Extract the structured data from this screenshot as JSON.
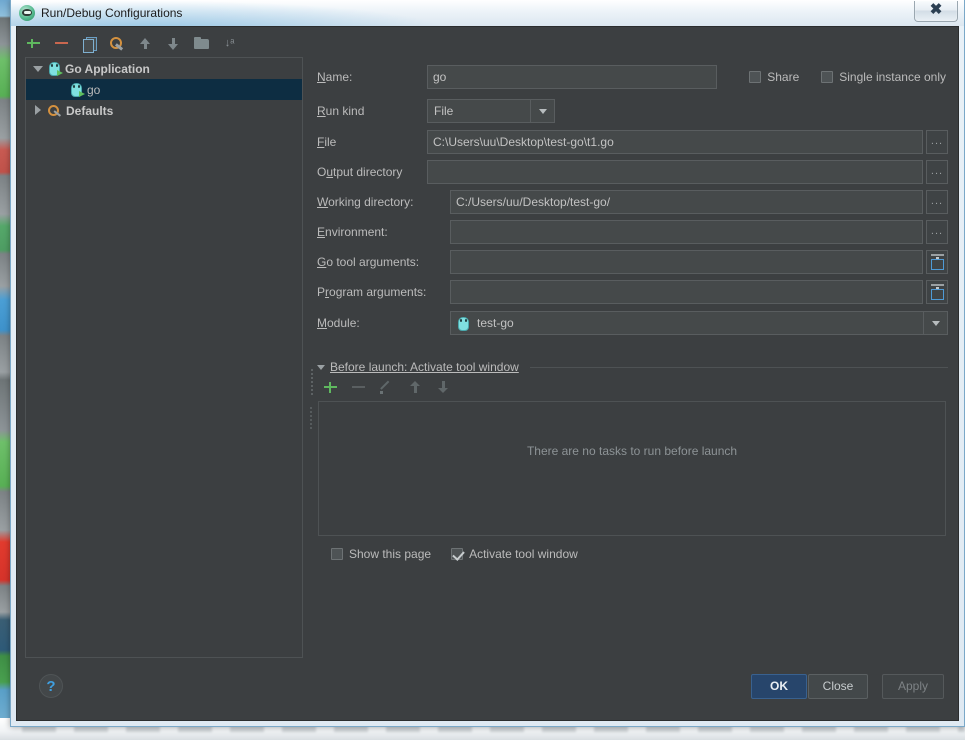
{
  "window": {
    "title": "Run/Debug Configurations",
    "title_icon": "go-app-icon",
    "close_label": "✕"
  },
  "left_panel": {
    "toolbar": [
      {
        "name": "add-configuration-button",
        "icon": "plus-icon",
        "label": "+"
      },
      {
        "name": "remove-configuration-button",
        "icon": "minus-icon",
        "label": "−"
      },
      {
        "name": "copy-configuration-button",
        "icon": "copy-icon",
        "label": ""
      },
      {
        "name": "edit-templates-button",
        "icon": "wrench-icon",
        "label": ""
      },
      {
        "name": "move-up-button",
        "icon": "arrow-up-icon",
        "label": ""
      },
      {
        "name": "move-down-button",
        "icon": "arrow-down-icon",
        "label": ""
      },
      {
        "name": "move-into-folder-button",
        "icon": "folder-icon",
        "label": ""
      },
      {
        "name": "sort-configurations-button",
        "icon": "sort-az-icon",
        "label": "↓ᵃ𝘇"
      }
    ],
    "tree": [
      {
        "name": "tree-group-go-application",
        "label": "Go Application",
        "icon": "go-gopher-icon",
        "expanded": true,
        "selected": false,
        "level": 0
      },
      {
        "name": "tree-item-go",
        "label": "go",
        "icon": "go-gopher-icon",
        "expanded": false,
        "selected": true,
        "level": 1
      },
      {
        "name": "tree-group-defaults",
        "label": "Defaults",
        "icon": "wrench-icon",
        "expanded": false,
        "selected": false,
        "level": 0
      }
    ]
  },
  "form": {
    "name_label": "Name:",
    "name_value": "go",
    "share_label": "Share",
    "share_checked": false,
    "single_instance_label": "Single instance only",
    "single_instance_checked": false,
    "run_kind_label": "Run kind",
    "run_kind_value": "File",
    "file_label": "File",
    "file_value": "C:\\Users\\uu\\Desktop\\test-go\\t1.go",
    "output_directory_label": "Output directory",
    "output_directory_value": "",
    "working_directory_label": "Working directory:",
    "working_directory_value": "C:/Users/uu/Desktop/test-go/",
    "environment_label": "Environment:",
    "environment_value": "",
    "go_tool_arguments_label": "Go tool arguments:",
    "go_tool_arguments_value": "",
    "program_arguments_label": "Program arguments:",
    "program_arguments_value": "",
    "module_label": "Module:",
    "module_value": "test-go",
    "browse_button_label": "...",
    "expand_button_icon": "insert-macro-icon"
  },
  "before_launch": {
    "header": "Before launch: Activate tool window",
    "toolbar": [
      {
        "name": "add-task-button",
        "icon": "plus-icon",
        "enabled": true
      },
      {
        "name": "remove-task-button",
        "icon": "minus-icon",
        "enabled": false
      },
      {
        "name": "edit-task-button",
        "icon": "pencil-icon",
        "enabled": false
      },
      {
        "name": "move-task-up-button",
        "icon": "arrow-up-icon",
        "enabled": false
      },
      {
        "name": "move-task-down-button",
        "icon": "arrow-down-icon",
        "enabled": false
      }
    ],
    "empty_text": "There are no tasks to run before launch",
    "show_this_page_label": "Show this page",
    "show_this_page_checked": false,
    "activate_tool_window_label": "Activate tool window",
    "activate_tool_window_checked": true
  },
  "footer": {
    "help_label": "?",
    "ok_label": "OK",
    "close_label": "Close",
    "apply_label": "Apply",
    "apply_enabled": false
  },
  "colors": {
    "dialog_bg": "#3c3f41",
    "input_bg": "#45494a",
    "selection_bg": "#0d2d42",
    "accent_green": "#5fb85f",
    "accent_blue": "#4e9ad6",
    "ok_button_bg": "#27456b",
    "text": "#bbbbbb",
    "gopher_cyan": "#7fe0e0"
  }
}
